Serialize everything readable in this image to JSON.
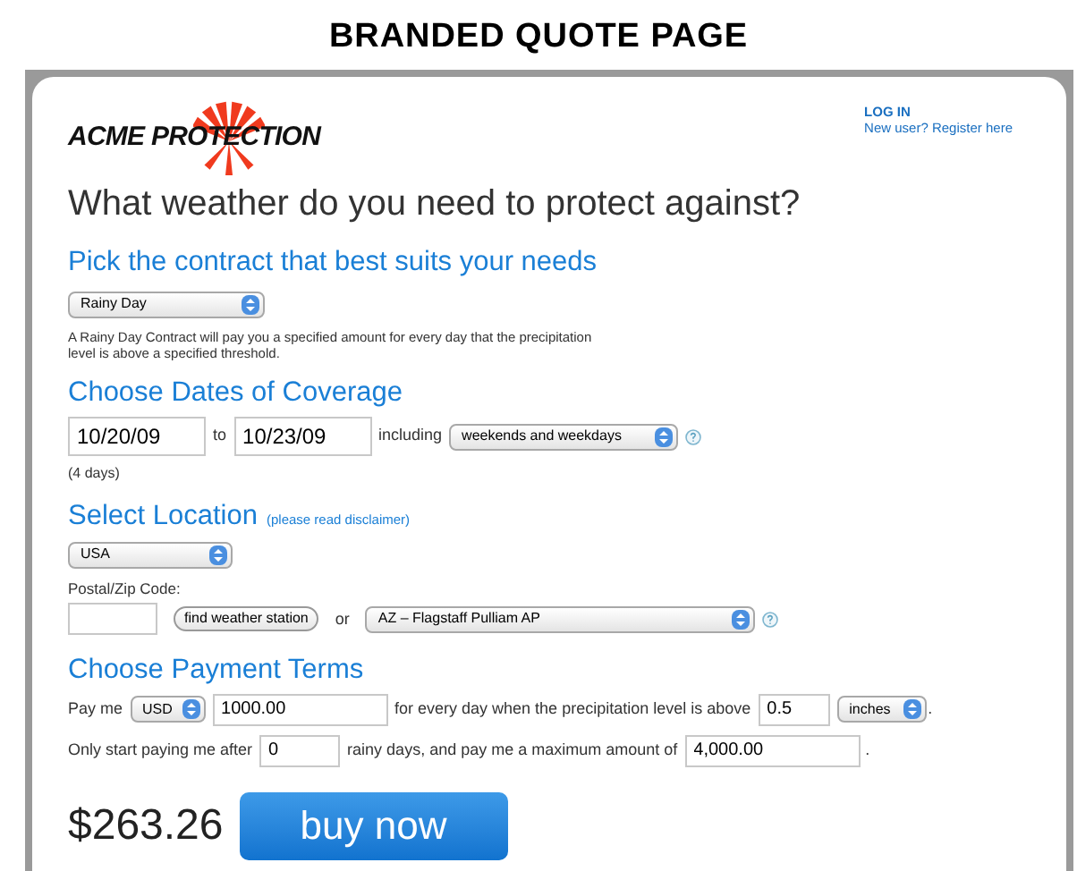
{
  "slide_title": "BRANDED QUOTE PAGE",
  "logo": {
    "text": "ACME PROTECTION"
  },
  "account": {
    "login": "LOG IN",
    "register": "New user? Register here"
  },
  "heading": "What weather do you need to protect against?",
  "contract": {
    "title": "Pick the contract that best suits your needs",
    "select": "Rainy Day",
    "description": "A Rainy Day Contract will pay you a specified amount for every day that the precipitation level is above a specified threshold."
  },
  "dates": {
    "title": "Choose Dates of Coverage",
    "from": "10/20/09",
    "to_label": "to",
    "to": "10/23/09",
    "including_label": "including",
    "including": "weekends and weekdays",
    "summary": "(4 days)"
  },
  "location": {
    "title": "Select Location",
    "note": "(please read disclaimer)",
    "country": "USA",
    "postal_label": "Postal/Zip Code:",
    "find_button": "find weather station",
    "or_label": "or",
    "station": "AZ – Flagstaff Pulliam AP"
  },
  "payment": {
    "title": "Choose Payment Terms",
    "pay_label": "Pay me",
    "currency": "USD",
    "amount": "1000.00",
    "condition_label": "for every day when the precipitation level is above",
    "threshold": "0.5",
    "unit": "inches",
    "unit_end": ".",
    "start_label": "Only start paying me after",
    "start_days": "0",
    "max_label": "rainy days, and pay me a maximum amount of",
    "max_amount": "4,000.00",
    "max_end": "."
  },
  "price": "$263.26",
  "buy_button": "buy now"
}
